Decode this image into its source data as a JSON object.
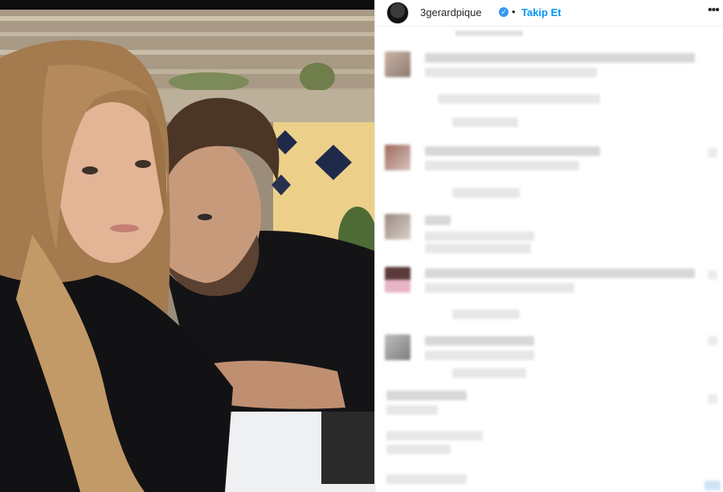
{
  "post": {
    "username": "3gerardpique",
    "separator": "•",
    "follow_label": "Takip Et",
    "more_icon": "more-options-icon",
    "verified_icon": "verified-badge-icon",
    "verified_glyph": "✓",
    "more_glyph": "•••"
  },
  "photo": {
    "subject": "selfie-photo"
  },
  "comments": {
    "state": "blurred"
  }
}
